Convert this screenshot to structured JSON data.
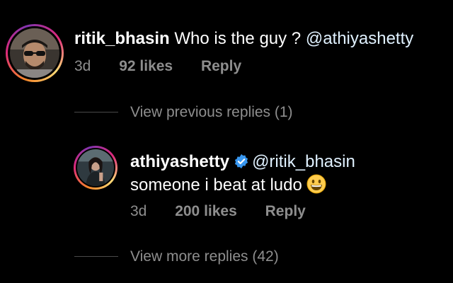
{
  "comment": {
    "username": "ritik_bhasin",
    "text": "Who is the guy ?",
    "mention": "@athiyashetty",
    "time": "3d",
    "likes": "92 likes",
    "reply_label": "Reply"
  },
  "view_previous": "View previous replies (1)",
  "reply": {
    "username": "athiyashetty",
    "mention": "@ritik_bhasin",
    "text": "someone i beat at ludo",
    "emoji": "grinning-face-emoji",
    "verified_icon": "verified-badge-icon",
    "time": "3d",
    "likes": "200 likes",
    "reply_label": "Reply"
  },
  "view_more": "View more replies (42)",
  "colors": {
    "background": "#000000",
    "text": "#ffffff",
    "secondary": "#8e8e8e",
    "verified": "#3897f0"
  }
}
